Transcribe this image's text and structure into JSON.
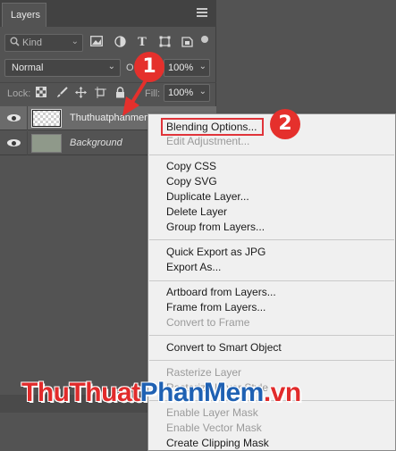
{
  "panel": {
    "tab_title": "Layers",
    "kind_label": "Kind",
    "blend_mode": "Normal",
    "opacity_label": "O",
    "opacity_value": "100%",
    "lock_label": "Lock:",
    "fill_label": "Fill:",
    "fill_value": "100%"
  },
  "layers": [
    {
      "name": "Thuthuatphanmem",
      "selected": true
    },
    {
      "name": "Background",
      "selected": false
    }
  ],
  "context_menu": {
    "items": [
      {
        "label": "Blending Options...",
        "enabled": true
      },
      {
        "label": "Edit Adjustment...",
        "enabled": false
      },
      {
        "label": "Copy CSS",
        "enabled": true
      },
      {
        "label": "Copy SVG",
        "enabled": true
      },
      {
        "label": "Duplicate Layer...",
        "enabled": true
      },
      {
        "label": "Delete Layer",
        "enabled": true
      },
      {
        "label": "Group from Layers...",
        "enabled": true
      },
      {
        "label": "Quick Export as JPG",
        "enabled": true
      },
      {
        "label": "Export As...",
        "enabled": true
      },
      {
        "label": "Artboard from Layers...",
        "enabled": true
      },
      {
        "label": "Frame from Layers...",
        "enabled": true
      },
      {
        "label": "Convert to Frame",
        "enabled": false
      },
      {
        "label": "Convert to Smart Object",
        "enabled": true
      },
      {
        "label": "Rasterize Layer",
        "enabled": false
      },
      {
        "label": "Rasterize Layer Style",
        "enabled": false
      },
      {
        "label": "Enable Layer Mask",
        "enabled": false
      },
      {
        "label": "Enable Vector Mask",
        "enabled": false
      },
      {
        "label": "Create Clipping Mask",
        "enabled": true
      }
    ]
  },
  "annotations": {
    "step1": "1",
    "step2": "2",
    "accent_color": "#e5302c"
  },
  "watermark": {
    "part1": "Thu",
    "part2": "Thuat",
    "part3": "PhanMem",
    "part4": ".vn"
  }
}
